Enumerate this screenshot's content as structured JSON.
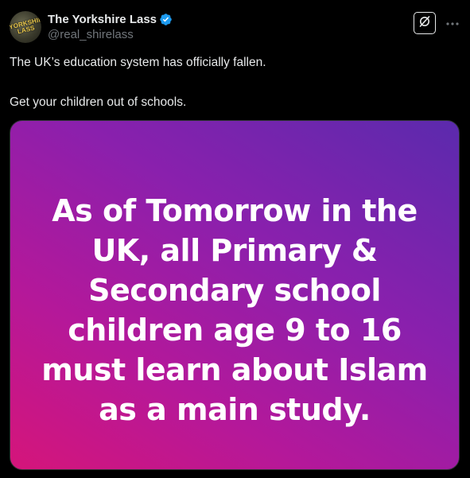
{
  "author": {
    "display_name": "The Yorkshire Lass",
    "handle": "@real_shirelass",
    "avatar_text": "YORKSHIRE LASS",
    "verified": true,
    "verified_color": "#1d9bf0"
  },
  "actions": {
    "grok_icon": "grok-icon",
    "more_icon": "more-dots-icon"
  },
  "tweet": {
    "paragraphs": [
      "The UK’s education system has officially fallen.",
      "Get your children out of schools."
    ]
  },
  "media": {
    "lines": [
      "As of Tomorrow in the",
      "UK, all Primary &",
      "Secondary school",
      "children age 9 to 16",
      "must learn about Islam",
      "as a main study."
    ],
    "gradient_colors": [
      "#d5157a",
      "#b4189a",
      "#8a20ad",
      "#5b2aad"
    ]
  }
}
